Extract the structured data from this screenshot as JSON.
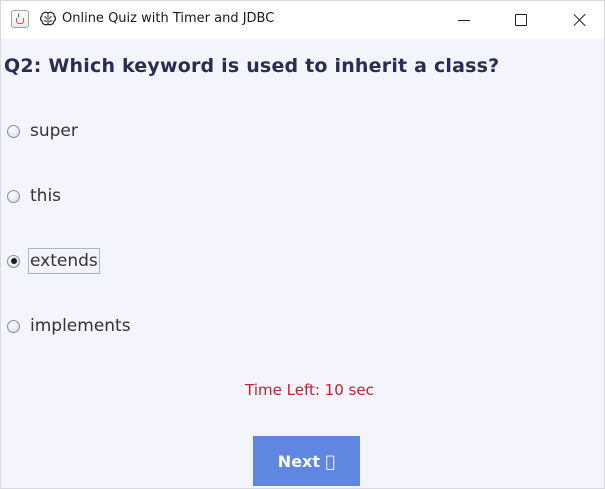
{
  "window": {
    "title": "Online Quiz with Timer and JDBC",
    "icons": [
      "java-app-icon",
      "brain-icon"
    ],
    "controls": [
      "minimize",
      "maximize",
      "close"
    ]
  },
  "quiz": {
    "question": "Q2: Which keyword is used to inherit a class?",
    "options": [
      {
        "label": "super",
        "selected": false
      },
      {
        "label": "this",
        "selected": false
      },
      {
        "label": "extends",
        "selected": true
      },
      {
        "label": "implements",
        "selected": false
      }
    ],
    "timer_text": "Time Left: 10 sec",
    "next_label": "Next ⃞"
  },
  "colors": {
    "background": "#f4f4fc",
    "question_text": "#2b2b55",
    "timer_text": "#cc1c2c",
    "next_button_bg": "#5f86e0",
    "next_button_text": "#ffffff"
  }
}
